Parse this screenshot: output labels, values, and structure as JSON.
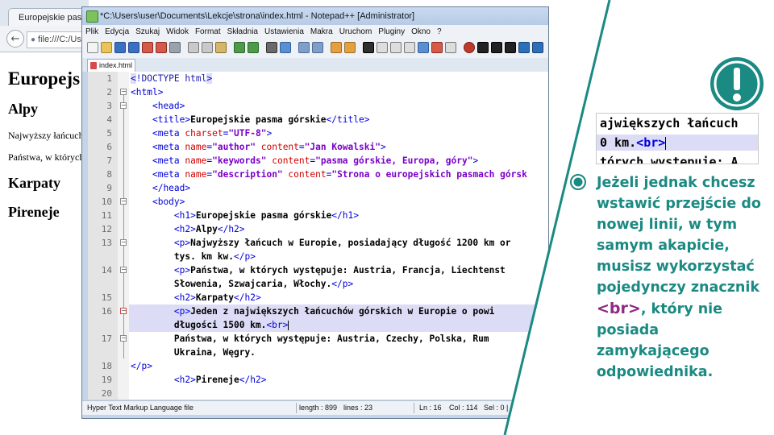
{
  "browser": {
    "tab_title": "Europejskie pasma",
    "url": "file:///C:/Us",
    "back_icon": "back-arrow-icon",
    "page": {
      "h1": "Europejs",
      "h2_alpy": "Alpy",
      "p1": "Najwyższy łańcuch",
      "p2": "Państwa, w których",
      "h2_karpaty": "Karpaty",
      "h2_pireneje": "Pireneje"
    }
  },
  "notepad": {
    "title": "*C:\\Users\\user\\Documents\\Lekcje\\strona\\index.html - Notepad++ [Administrator]",
    "menu": [
      "Plik",
      "Edycja",
      "Szukaj",
      "Widok",
      "Format",
      "Składnia",
      "Ustawienia",
      "Makra",
      "Uruchom",
      "Pluginy",
      "Okno",
      "?"
    ],
    "file_tab": "index.html",
    "line_numbers": [
      "1",
      "2",
      "3",
      "4",
      "5",
      "6",
      "7",
      "8",
      "9",
      "10",
      "11",
      "12",
      "13",
      "",
      "14",
      "",
      "15",
      "16",
      "",
      "17",
      "",
      "18",
      "19",
      "20"
    ],
    "status": {
      "filetype": "Hyper Text Markup Language file",
      "length": "length : 899",
      "lines": "lines : 23",
      "ln": "Ln : 16",
      "col": "Col : 114",
      "sel": "Sel : 0 | 0"
    }
  },
  "code": {
    "l1_doctype": "!DOCTYPE html",
    "html": "html",
    "head": "head",
    "title_tag": "title",
    "title_text": "Europejskie pasma górskie",
    "meta": "meta",
    "charset_attr": "charset",
    "charset_val": "\"UTF-8\"",
    "name_attr": "name",
    "content_attr": "content",
    "author_val": "\"author\"",
    "author_content": "\"Jan Kowalski\"",
    "keywords_val": "\"keywords\"",
    "keywords_content": "\"pasma górskie, Europa, góry\"",
    "description_val": "\"description\"",
    "description_content": "\"Strona o europejskich pasmach górsk",
    "body": "body",
    "h1": "h1",
    "h1_text": "Europejskie pasma górskie",
    "h2": "h2",
    "p": "p",
    "br": "br",
    "alpy": "Alpy",
    "p13a": "Najwyższy łańcuch w Europie, posiadający długość 1200 km or",
    "p13b": "tys. km kw.",
    "p14a": "Państwa, w których występuje: Austria, Francja, Liechtenst",
    "p14b": "Słowenia, Szwajcaria, Włochy.",
    "karpaty": "Karpaty",
    "p16a": "Jeden z największych łańcuchów górskich w Europie o powi",
    "p16b": "długości 1500 km.",
    "p17a": "Państwa, w których występuje: Austria, Czechy, Polska, Rum",
    "p17b": "Ukraina, Węgry.",
    "pireneje": "Pireneje"
  },
  "zoom_snippet": {
    "line1": "ajwiększych łańcuch",
    "line2_text": "0 km.",
    "line3": "tórych występuje: A"
  },
  "note": {
    "part1": "Jeżeli jednak chcesz wstawić przejście do nowej linii, w tym samym akapicie, musisz wykorzystać pojedynczy znacznik",
    "tag": "<br>",
    "part2": ", który nie posiada zamykającego odpowiednika."
  },
  "colors": {
    "accent_teal": "#1a8a82",
    "tag_purple": "#8e2a86",
    "html_tag_blue": "#0000dd",
    "html_attr_red": "#d00000",
    "html_value_purple": "#7a00c8",
    "line_highlight": "#dcdcf6"
  },
  "icons": {
    "alert": "exclamation-alert-icon",
    "bullet": "bullet-circle-icon"
  }
}
